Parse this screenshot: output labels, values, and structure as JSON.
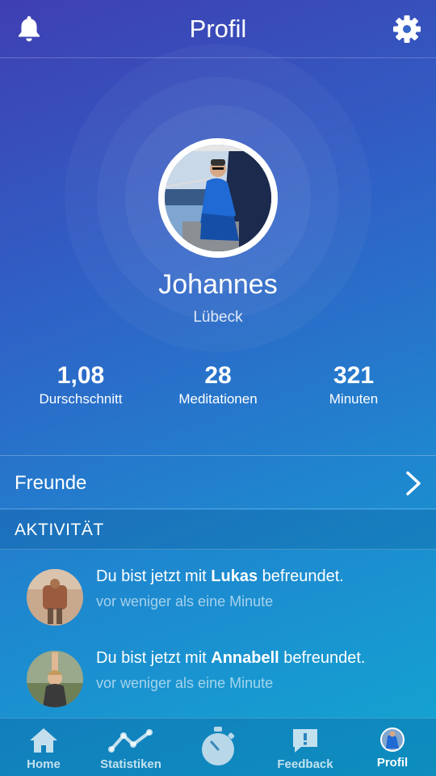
{
  "header": {
    "title": "Profil",
    "left_icon": "bell-icon",
    "right_icon": "gear-icon"
  },
  "profile": {
    "name": "Johannes",
    "city": "Lübeck"
  },
  "stats": [
    {
      "value": "1,08",
      "label": "Durschschnitt"
    },
    {
      "value": "28",
      "label": "Meditationen"
    },
    {
      "value": "321",
      "label": "Minuten"
    }
  ],
  "friends": {
    "label": "Freunde"
  },
  "activity": {
    "heading": "AKTIVITÄT",
    "items": [
      {
        "prefix": "Du bist jetzt mit ",
        "name": "Lukas",
        "suffix": " befreundet.",
        "time": "vor weniger als eine Minute"
      },
      {
        "prefix": "Du bist jetzt mit ",
        "name": "Annabell",
        "suffix": " befreundet.",
        "time": "vor weniger als eine Minute"
      }
    ]
  },
  "tabbar": {
    "items": [
      {
        "label": "Home",
        "icon": "home-icon"
      },
      {
        "label": "Statistiken",
        "icon": "chart-line-icon"
      },
      {
        "label": "",
        "icon": "stopwatch-icon"
      },
      {
        "label": "Feedback",
        "icon": "feedback-icon"
      },
      {
        "label": "Profil",
        "icon": "profile-avatar-icon"
      }
    ],
    "active": "Profil"
  },
  "colors": {
    "gradient_start": "#3f3fb2",
    "gradient_end": "#12a7d1",
    "text": "#ffffff"
  }
}
